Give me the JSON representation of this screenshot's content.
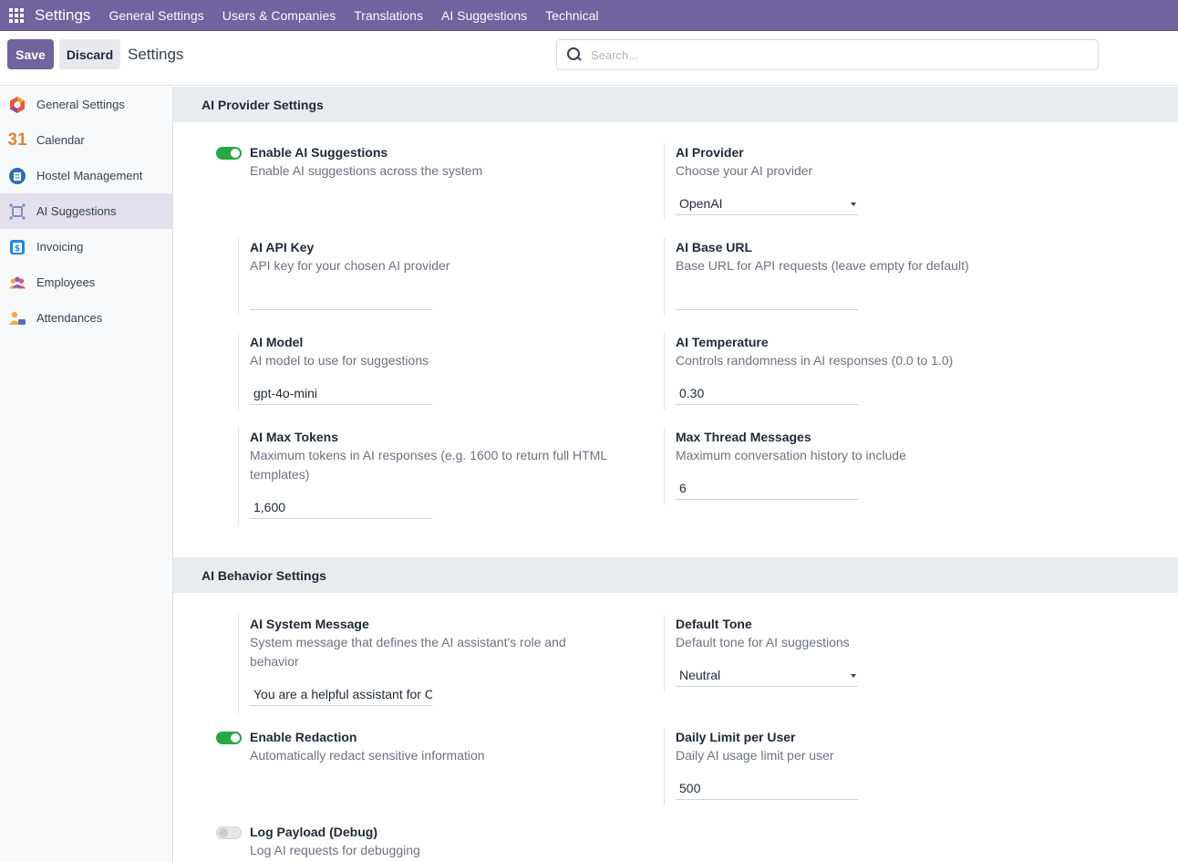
{
  "navbar": {
    "app_title": "Settings",
    "menu": [
      "General Settings",
      "Users & Companies",
      "Translations",
      "AI Suggestions",
      "Technical"
    ]
  },
  "controls": {
    "save_label": "Save",
    "discard_label": "Discard",
    "breadcrumb": "Settings",
    "search_placeholder": "Search..."
  },
  "sidebar": {
    "items": [
      {
        "label": "General Settings",
        "icon": "odoo-icon"
      },
      {
        "label": "Calendar",
        "icon": "calendar-icon"
      },
      {
        "label": "Hostel Management",
        "icon": "hostel-icon"
      },
      {
        "label": "AI Suggestions",
        "icon": "ai-icon",
        "active": true
      },
      {
        "label": "Invoicing",
        "icon": "invoice-icon"
      },
      {
        "label": "Employees",
        "icon": "employees-icon"
      },
      {
        "label": "Attendances",
        "icon": "attendances-icon"
      }
    ],
    "calendar_glyph": "31"
  },
  "provider_section": {
    "title": "AI Provider Settings",
    "enable_ai": {
      "title": "Enable AI Suggestions",
      "desc": "Enable AI suggestions across the system",
      "enabled": true
    },
    "provider": {
      "title": "AI Provider",
      "desc": "Choose your AI provider",
      "value": "OpenAI"
    },
    "api_key": {
      "title": "AI API Key",
      "desc": "API key for your chosen AI provider",
      "value": ""
    },
    "base_url": {
      "title": "AI Base URL",
      "desc": "Base URL for API requests (leave empty for default)",
      "value": ""
    },
    "model": {
      "title": "AI Model",
      "desc": "AI model to use for suggestions",
      "value": "gpt-4o-mini"
    },
    "temperature": {
      "title": "AI Temperature",
      "desc": "Controls randomness in AI responses (0.0 to 1.0)",
      "value": "0.30"
    },
    "max_tokens": {
      "title": "AI Max Tokens",
      "desc": "Maximum tokens in AI responses (e.g. 1600 to return full HTML templates)",
      "value": "1,600"
    },
    "max_thread": {
      "title": "Max Thread Messages",
      "desc": "Maximum conversation history to include",
      "value": "6"
    }
  },
  "behavior_section": {
    "title": "AI Behavior Settings",
    "system_message": {
      "title": "AI System Message",
      "desc": "System message that defines the AI assistant's role and behavior",
      "value": "You are a helpful assistant for C"
    },
    "default_tone": {
      "title": "Default Tone",
      "desc": "Default tone for AI suggestions",
      "value": "Neutral"
    },
    "redaction": {
      "title": "Enable Redaction",
      "desc": "Automatically redact sensitive information",
      "enabled": true
    },
    "daily_limit": {
      "title": "Daily Limit per User",
      "desc": "Daily AI usage limit per user",
      "value": "500"
    },
    "log_payload": {
      "title": "Log Payload (Debug)",
      "desc": "Log AI requests for debugging",
      "enabled": false
    }
  },
  "colors": {
    "brand": "#71639e",
    "toggle_on": "#28a745",
    "active_sidebar": "#e3dfed"
  }
}
